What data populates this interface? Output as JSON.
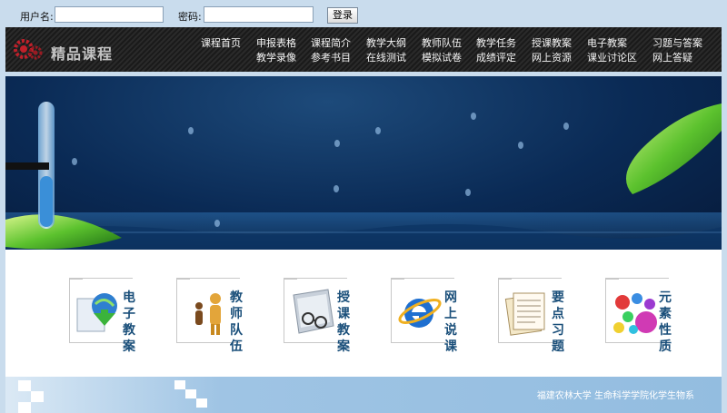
{
  "login": {
    "username_label": "用户名:",
    "password_label": "密码:",
    "username_value": "",
    "password_value": "",
    "submit_label": "登录"
  },
  "header": {
    "site_title": "精品课程",
    "nav": [
      {
        "label": "课程首页"
      },
      {
        "label": "申报表格"
      },
      {
        "label": "课程简介"
      },
      {
        "label": "教学大纲"
      },
      {
        "label": "教师队伍"
      },
      {
        "label": "教学任务"
      },
      {
        "label": "授课教案"
      },
      {
        "label": "电子教案"
      },
      {
        "label": "习题与答案"
      },
      {
        "label": "教学录像"
      },
      {
        "label": "参考书目"
      },
      {
        "label": "在线测试"
      },
      {
        "label": "模拟试卷"
      },
      {
        "label": "成绩评定"
      },
      {
        "label": "网上资源"
      },
      {
        "label": "课业讨论区"
      },
      {
        "label": "网上答疑"
      }
    ]
  },
  "tiles": [
    {
      "label": "电子教案",
      "icon": "download-globe-icon"
    },
    {
      "label": "教师队伍",
      "icon": "teachers-figures-icon"
    },
    {
      "label": "授课教案",
      "icon": "glasses-book-icon"
    },
    {
      "label": "网上说课",
      "icon": "internet-explorer-icon"
    },
    {
      "label": "要点习题",
      "icon": "notes-pages-icon"
    },
    {
      "label": "元素性质",
      "icon": "color-balls-icon"
    }
  ],
  "footer": {
    "copyright": "福建农林大学  生命科学学院化学生物系"
  },
  "colors": {
    "page_bg": "#c9dced",
    "header_bg": "#222222",
    "banner_deep": "#0a2a55",
    "tile_label": "#1a4f7a",
    "footer_band": "#93bde0"
  }
}
